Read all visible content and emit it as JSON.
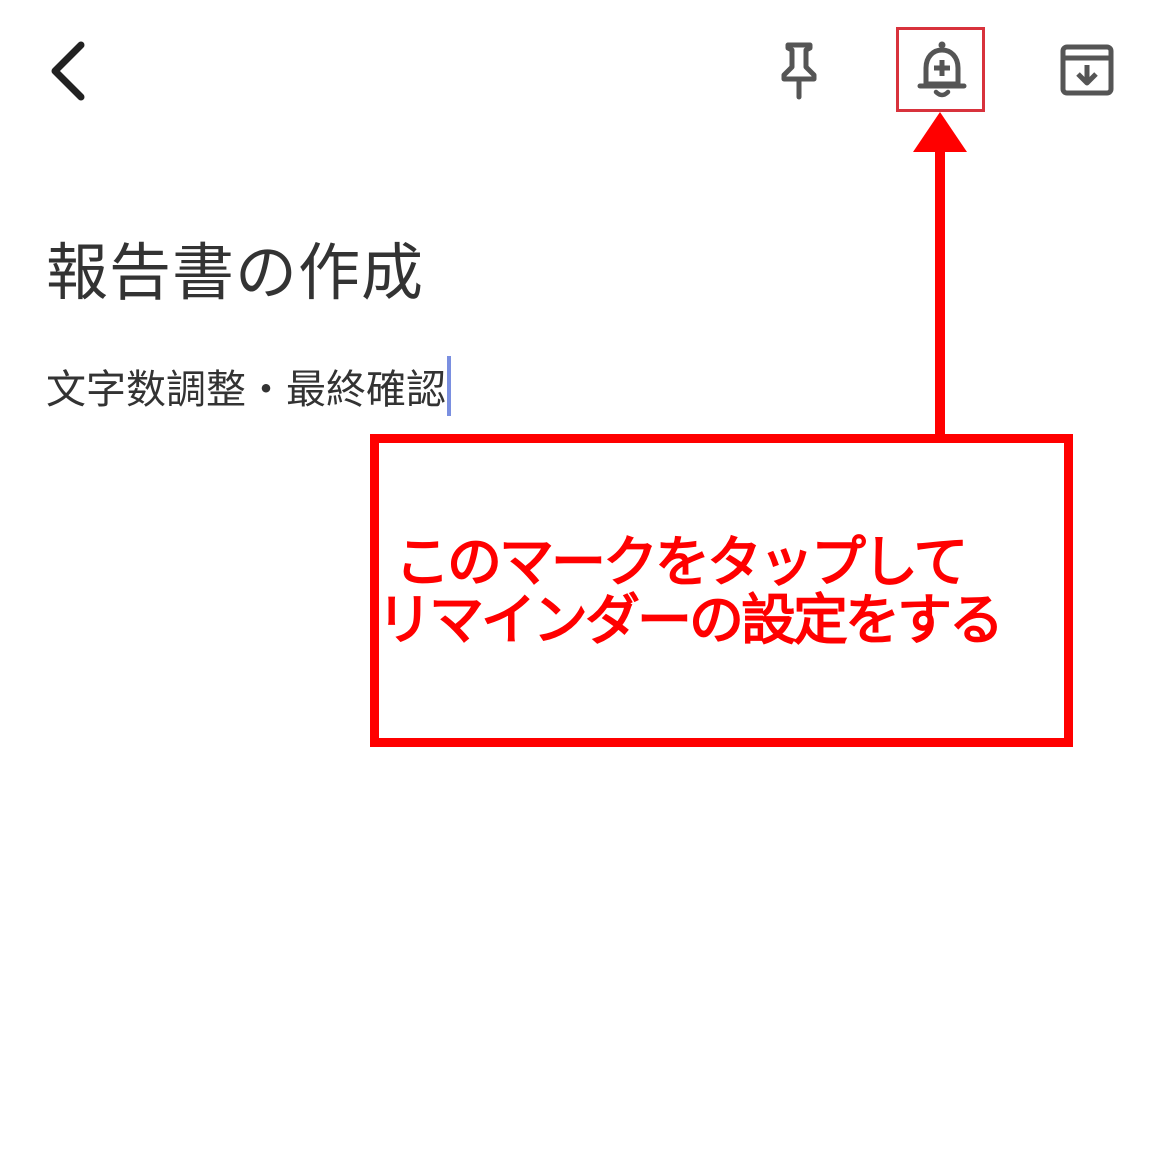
{
  "toolbar": {
    "back_icon": "chevron-left-icon",
    "pin_icon": "pin-icon",
    "reminder_icon": "bell-plus-icon",
    "archive_icon": "archive-download-icon"
  },
  "note": {
    "title": "報告書の作成",
    "body": "文字数調整・最終確認"
  },
  "annotation": {
    "line1": "このマークをタップして",
    "line2": "リマインダーの設定をする",
    "color": "#ff0000"
  }
}
